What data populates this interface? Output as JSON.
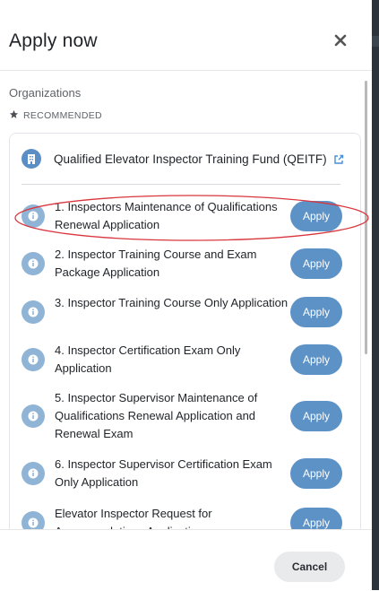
{
  "dialog": {
    "title": "Apply now",
    "close_icon": "close-icon"
  },
  "organizations": {
    "label": "Organizations",
    "recommended_label": "RECOMMENDED",
    "org_name": "Qualified Elevator Inspector Training Fund (QEITF)",
    "items": [
      {
        "label": "1. Inspectors Maintenance of Qualifications Renewal Application",
        "button": "Apply",
        "highlighted": true
      },
      {
        "label": "2. Inspector Training Course and Exam Package Application",
        "button": "Apply"
      },
      {
        "label": "3. Inspector Training Course Only Application",
        "button": "Apply"
      },
      {
        "label": "4. Inspector Certification Exam Only Application",
        "button": "Apply"
      },
      {
        "label": "5. Inspector Supervisor Maintenance of Qualifications Renewal Application and Renewal Exam",
        "button": "Apply"
      },
      {
        "label": "6. Inspector Supervisor Certification Exam Only Application",
        "button": "Apply"
      },
      {
        "label": "Elevator Inspector Request for Accommodations Application",
        "button": "Apply"
      }
    ]
  },
  "footer": {
    "cancel_label": "Cancel"
  },
  "colors": {
    "accent": "#5d92c7",
    "info_icon": "#8fb4d6",
    "highlight": "#d9363e"
  }
}
